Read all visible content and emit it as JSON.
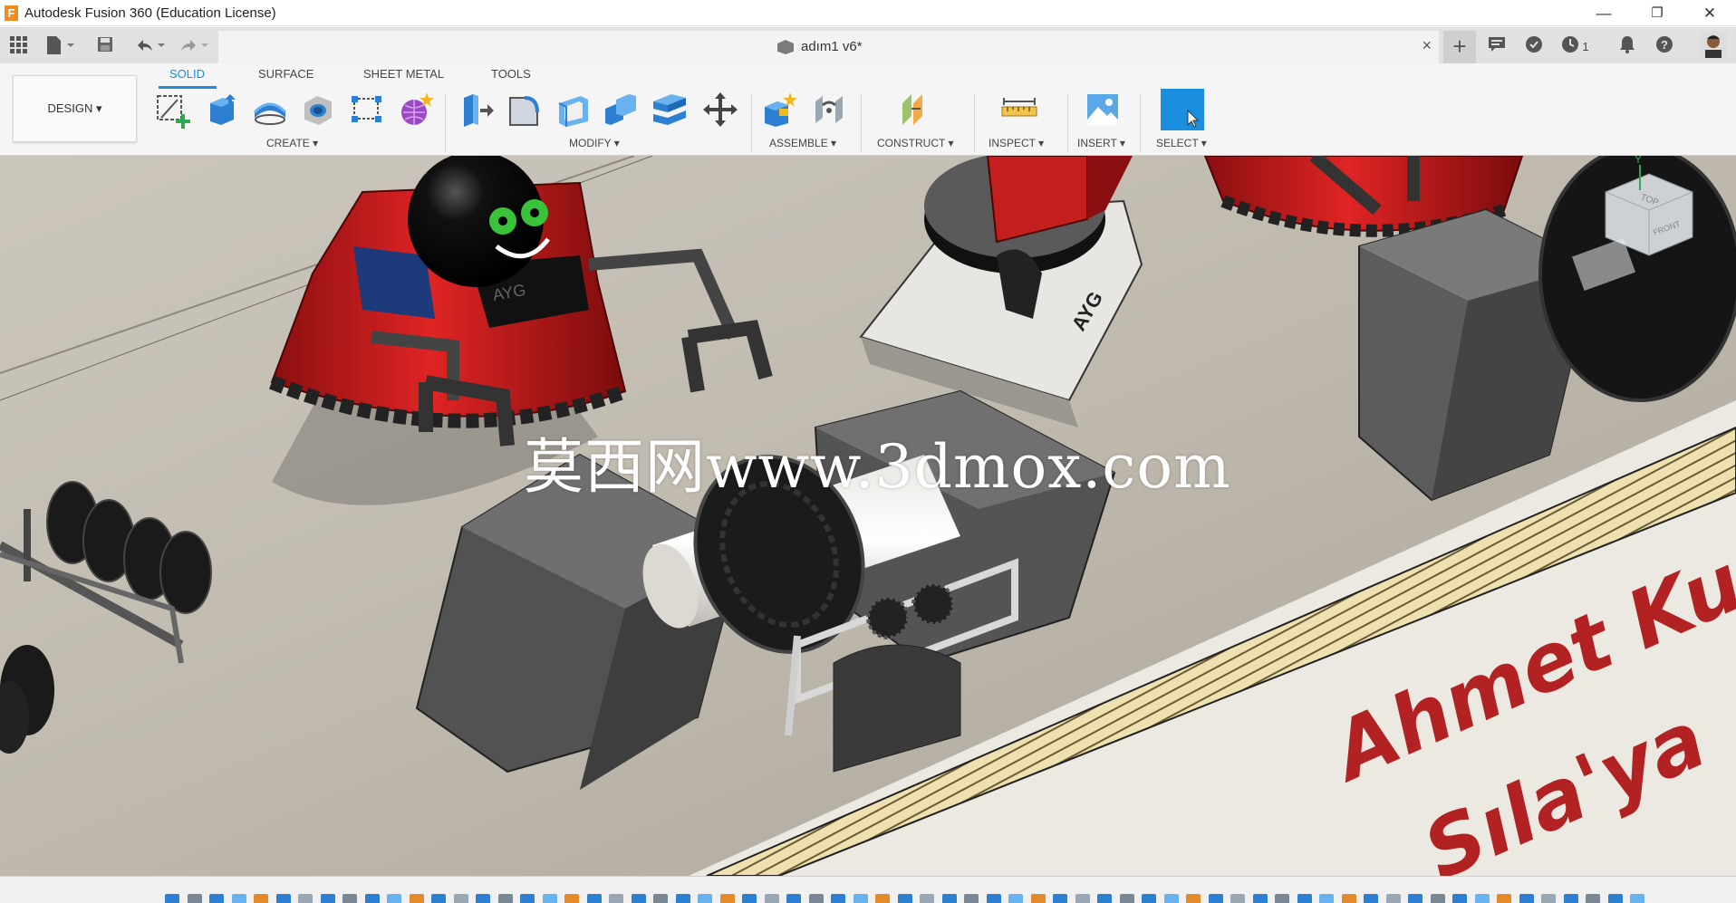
{
  "window": {
    "title": "Autodesk Fusion 360 (Education License)",
    "app_logo": "F",
    "minimize": "—",
    "restore": "❐",
    "close": "✕"
  },
  "document": {
    "name": "adım1 v6*",
    "close": "×"
  },
  "top_right": {
    "jobs_count": "1"
  },
  "ribbon": {
    "workspace": "DESIGN ▾",
    "tabs": [
      "SOLID",
      "SURFACE",
      "SHEET METAL",
      "TOOLS"
    ],
    "active_tab": "SOLID",
    "groups": {
      "create": "CREATE ▾",
      "modify": "MODIFY ▾",
      "assemble": "ASSEMBLE ▾",
      "construct": "CONSTRUCT ▾",
      "inspect": "INSPECT ▾",
      "insert": "INSERT ▾",
      "select": "SELECT ▾"
    }
  },
  "viewport": {
    "watermark": "莫西网www.3dmox.com",
    "banner_text_1": "Ahmet Ku",
    "banner_text_2": "Sıla'ya",
    "robot_label": "AYG",
    "viewcube_top": "TOP",
    "viewcube_side": "FRONT",
    "axis_y": "Y"
  },
  "colors": {
    "accent": "#1d8dd6",
    "robot_red": "#c81d1d",
    "block_gray": "#505050",
    "floor": "#bdb8ae"
  }
}
